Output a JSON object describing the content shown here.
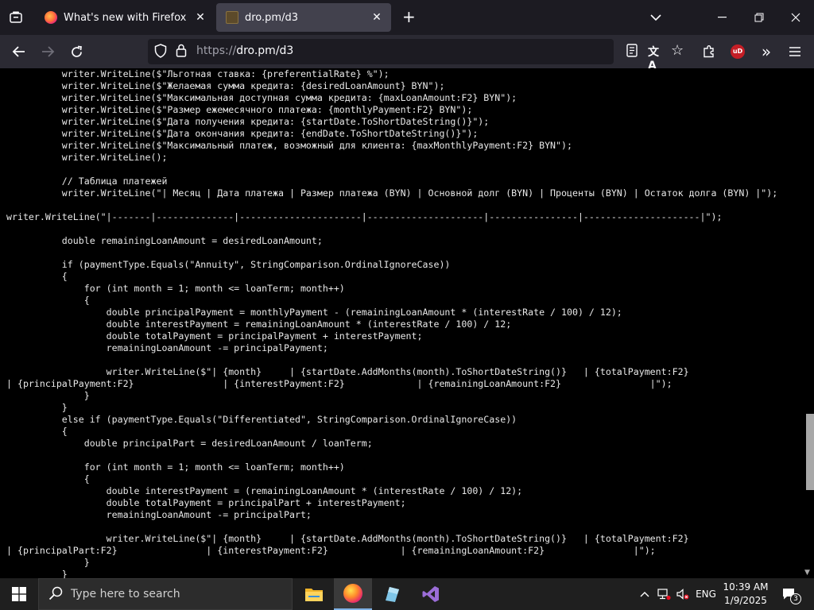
{
  "browser": {
    "tabs": [
      {
        "title": "What's new with Firefox"
      },
      {
        "title": "dro.pm/d3"
      }
    ],
    "new_tab_symbol": "+",
    "url_scheme": "https://",
    "url_host": "dro.pm/d3",
    "extension_badge": "uD"
  },
  "code_lines": [
    "          writer.WriteLine($\"Льготная ставка: {preferentialRate} %\");",
    "          writer.WriteLine($\"Желаемая сумма кредита: {desiredLoanAmount} BYN\");",
    "          writer.WriteLine($\"Максимальная доступная сумма кредита: {maxLoanAmount:F2} BYN\");",
    "          writer.WriteLine($\"Размер ежемесячного платежа: {monthlyPayment:F2} BYN\");",
    "          writer.WriteLine($\"Дата получения кредита: {startDate.ToShortDateString()}\");",
    "          writer.WriteLine($\"Дата окончания кредита: {endDate.ToShortDateString()}\");",
    "          writer.WriteLine($\"Максимальный платеж, возможный для клиента: {maxMonthlyPayment:F2} BYN\");",
    "          writer.WriteLine();",
    "",
    "          // Таблица платежей",
    "          writer.WriteLine(\"| Месяц | Дата платежа | Размер платежа (BYN) | Основной долг (BYN) | Проценты (BYN) | Остаток долга (BYN) |\");",
    "",
    "writer.WriteLine(\"|-------|--------------|----------------------|---------------------|----------------|---------------------|\");",
    "",
    "          double remainingLoanAmount = desiredLoanAmount;",
    "",
    "          if (paymentType.Equals(\"Annuity\", StringComparison.OrdinalIgnoreCase))",
    "          {",
    "              for (int month = 1; month <= loanTerm; month++)",
    "              {",
    "                  double principalPayment = monthlyPayment - (remainingLoanAmount * (interestRate / 100) / 12);",
    "                  double interestPayment = remainingLoanAmount * (interestRate / 100) / 12;",
    "                  double totalPayment = principalPayment + interestPayment;",
    "                  remainingLoanAmount -= principalPayment;",
    "",
    "                  writer.WriteLine($\"| {month}     | {startDate.AddMonths(month).ToShortDateString()}   | {totalPayment:F2}",
    "| {principalPayment:F2}                | {interestPayment:F2}             | {remainingLoanAmount:F2}                |\");",
    "              }",
    "          }",
    "          else if (paymentType.Equals(\"Differentiated\", StringComparison.OrdinalIgnoreCase))",
    "          {",
    "              double principalPart = desiredLoanAmount / loanTerm;",
    "",
    "              for (int month = 1; month <= loanTerm; month++)",
    "              {",
    "                  double interestPayment = (remainingLoanAmount * (interestRate / 100) / 12);",
    "                  double totalPayment = principalPart + interestPayment;",
    "                  remainingLoanAmount -= principalPart;",
    "",
    "                  writer.WriteLine($\"| {month}     | {startDate.AddMonths(month).ToShortDateString()}   | {totalPayment:F2}",
    "| {principalPart:F2}                | {interestPayment:F2}             | {remainingLoanAmount:F2}                |\");",
    "              }",
    "          }"
  ],
  "taskbar": {
    "search_placeholder": "Type here to search",
    "language": "ENG",
    "time": "10:39 AM",
    "date": "1/9/2025",
    "notification_count": "3"
  },
  "colors": {
    "tabbar_bg": "#1c1b22",
    "navbar_bg": "#2b2a33",
    "active_tab_bg": "#42414d",
    "taskbar_bg": "#1f1f1f"
  }
}
